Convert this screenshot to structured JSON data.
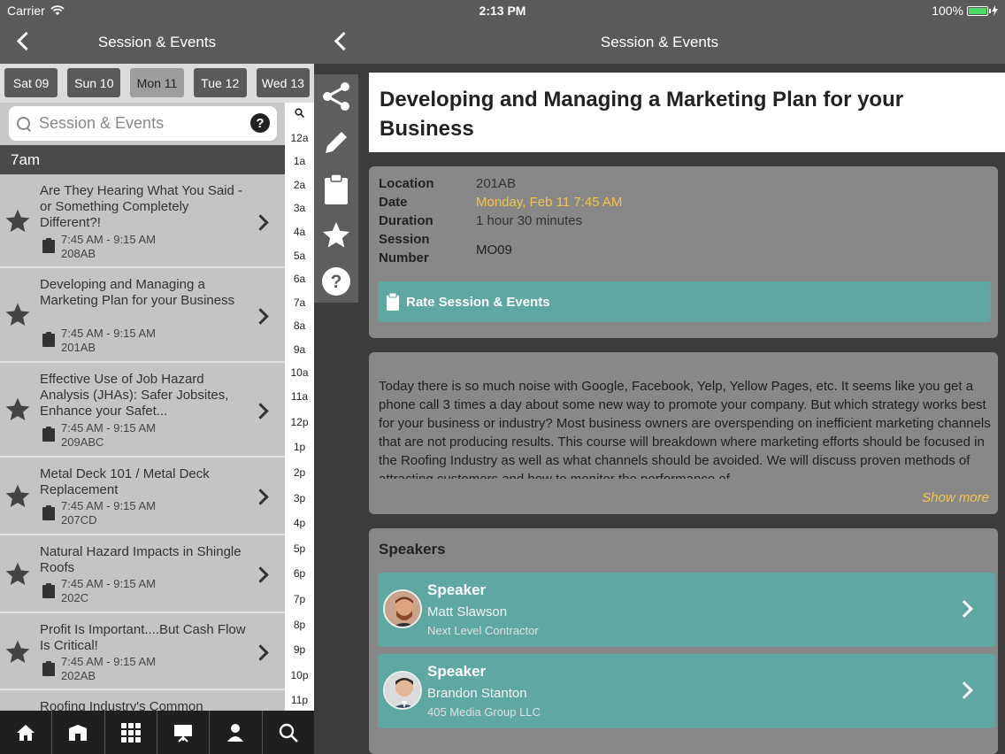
{
  "status": {
    "carrier": "Carrier",
    "time": "2:13 PM",
    "battery": "100%"
  },
  "left": {
    "nav_title": "Session & Events",
    "dates": [
      "Sat 09",
      "Sun 10",
      "Mon 11",
      "Tue 12",
      "Wed 13"
    ],
    "active_date_index": 2,
    "search_placeholder": "Session & Events",
    "help_glyph": "?",
    "section": "7am",
    "sessions": [
      {
        "title": "Are They Hearing What You Said - or Something Completely Different?!",
        "time": "7:45 AM - 9:15 AM",
        "room": "208AB"
      },
      {
        "title": "Developing and Managing a Marketing Plan for your Business",
        "time": "7:45 AM - 9:15 AM",
        "room": "201AB"
      },
      {
        "title": "Effective Use of Job Hazard Analysis (JHAs): Safer Jobsites, Enhance your Safet...",
        "time": "7:45 AM - 9:15 AM",
        "room": "209ABC"
      },
      {
        "title": "Metal Deck 101 / Metal Deck Replacement",
        "time": "7:45 AM - 9:15 AM",
        "room": "207CD"
      },
      {
        "title": "Natural Hazard Impacts in Shingle Roofs",
        "time": "7:45 AM - 9:15 AM",
        "room": "202C"
      },
      {
        "title": "Profit Is Important....But Cash Flow Is Critical!",
        "time": "7:45 AM - 9:15 AM",
        "room": "202AB"
      },
      {
        "title": "Roofing Industry's Common",
        "time": "",
        "room": ""
      }
    ],
    "index_letters": [
      "12a",
      "1a",
      "2a",
      "3a",
      "4a",
      "5a",
      "6a",
      "7a",
      "8a",
      "9a",
      "10a",
      "11a",
      "12p",
      "1p",
      "2p",
      "3p",
      "4p",
      "5p",
      "6p",
      "7p",
      "8p",
      "9p",
      "10p",
      "11p"
    ],
    "tabs": [
      "home-icon",
      "building-icon",
      "grid-icon",
      "presentation-icon",
      "person-icon",
      "search-icon"
    ]
  },
  "right": {
    "nav_title": "Session & Events",
    "session_title": "Developing and Managing a Marketing Plan for your Business",
    "info": {
      "location_label": "Location",
      "location": "201AB",
      "date_label": "Date",
      "date": "Monday, Feb 11 7:45 AM",
      "duration_label": "Duration",
      "duration": "1 hour 30 minutes",
      "session_label_1": "Session",
      "session_label_2": "Number",
      "session_number": "MO09"
    },
    "rate_label": "Rate Session & Events",
    "description": "Today there is so much noise with Google, Facebook, Yelp, Yellow Pages, etc.  It seems like you get a phone call 3 times a day about some new way to promote your company. But which strategy works best for your business or industry? Most business owners are overspending on inefficient marketing channels that are not producing results. This course will breakdown where marketing efforts should be focused in the Roofing Industry as well as what channels should be avoided. We will discuss proven methods of attracting customers and how to monitor the performance of",
    "show_more": "Show more",
    "speakers_heading": "Speakers",
    "speakers": [
      {
        "role": "Speaker",
        "name": "Matt Slawson",
        "org": "Next Level Contractor"
      },
      {
        "role": "Speaker",
        "name": "Brandon Stanton",
        "org": "405 Media Group LLC"
      }
    ]
  },
  "colors": {
    "teal": "#5ea8a1",
    "date_highlight": "#f3c34d",
    "navbar": "#5a5a5a"
  }
}
